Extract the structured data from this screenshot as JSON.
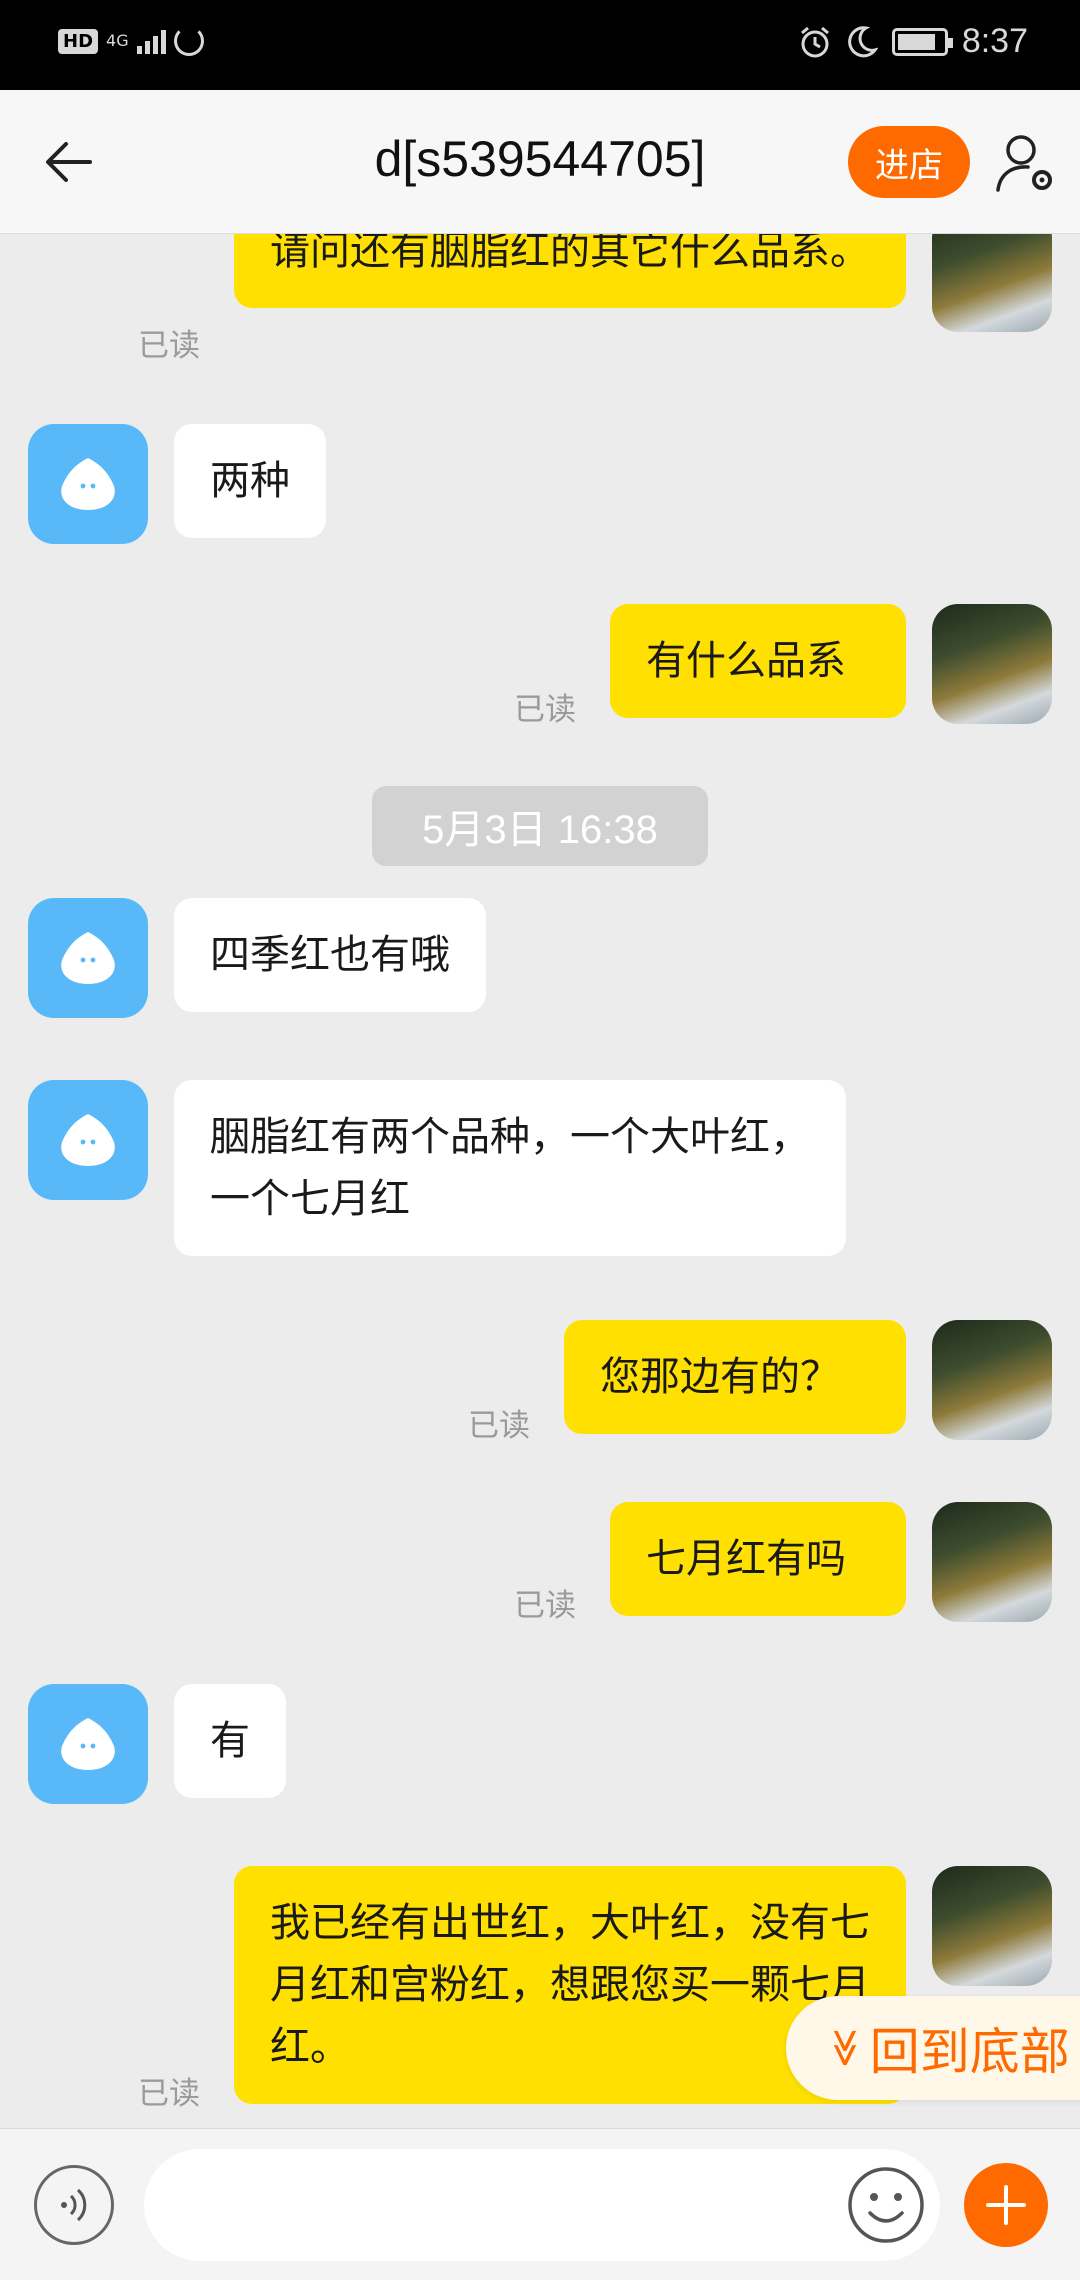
{
  "status_bar": {
    "hd": "HD",
    "network": "4G",
    "time": "8:37",
    "battery_level": 0.85
  },
  "header": {
    "title": "d[s539544705]",
    "enter_shop_label": "进店"
  },
  "messages": {
    "m1": {
      "text": "请问还有胭脂红的其它什么品系。",
      "read": "已读"
    },
    "m2": {
      "text": "两种"
    },
    "m3": {
      "text": "有什么品系",
      "read": "已读"
    },
    "timestamp": "5月3日 16:38",
    "m4": {
      "text": "四季红也有哦"
    },
    "m5": {
      "text": "胭脂红有两个品种，一个大叶红，一个七月红"
    },
    "m6": {
      "text": "您那边有的？",
      "read": "已读"
    },
    "m7": {
      "text": "七月红有吗",
      "read": "已读"
    },
    "m8": {
      "text": "有"
    },
    "m9": {
      "text": "我已经有出世红，大叶红，没有七月红和宫粉红，想跟您买一颗七月红。",
      "read": "已读"
    }
  },
  "jump_to_bottom": {
    "chevron": "≫",
    "label": "回到底部"
  },
  "input": {
    "placeholder": ""
  },
  "colors": {
    "accent": "#ff6a00",
    "my_bubble": "#ffe000",
    "shop_avatar": "#58b8f8"
  },
  "icons": [
    "back-arrow-icon",
    "user-settings-icon",
    "voice-icon",
    "emoji-icon",
    "plus-icon",
    "read-receipt",
    "alarm-icon",
    "moon-icon",
    "battery-icon",
    "signal-icon"
  ]
}
